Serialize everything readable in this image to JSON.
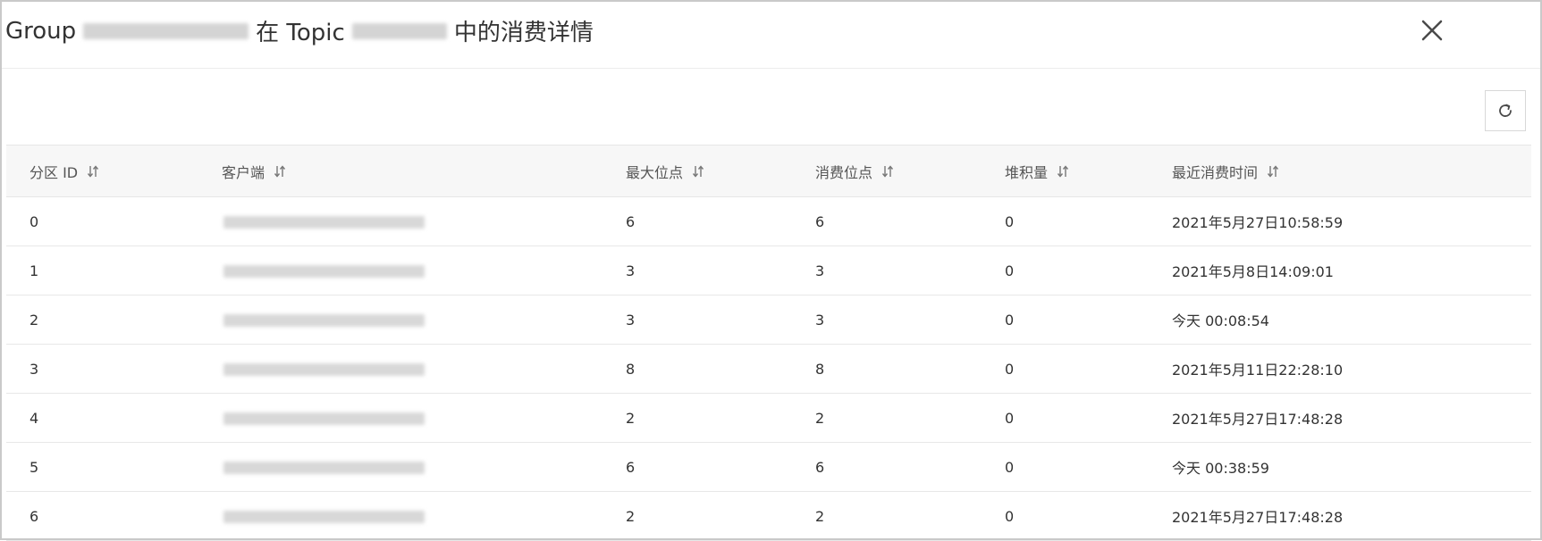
{
  "dialog": {
    "title": {
      "prefix": "Group",
      "middle": "在 Topic",
      "suffix": "中的消费详情"
    },
    "close_icon": "close-icon",
    "refresh_icon": "refresh-icon"
  },
  "table": {
    "headers": [
      "分区 ID",
      "客户端",
      "最大位点",
      "消费位点",
      "堆积量",
      "最近消费时间"
    ],
    "rows": [
      [
        "0",
        "6",
        "6",
        "0",
        "2021年5月27日10:58:59"
      ],
      [
        "1",
        "3",
        "3",
        "0",
        "2021年5月8日14:09:01"
      ],
      [
        "2",
        "3",
        "3",
        "0",
        "今天 00:08:54"
      ],
      [
        "3",
        "8",
        "8",
        "0",
        "2021年5月11日22:28:10"
      ],
      [
        "4",
        "2",
        "2",
        "0",
        "2021年5月27日17:48:28"
      ],
      [
        "5",
        "6",
        "6",
        "0",
        "今天 00:38:59"
      ],
      [
        "6",
        "2",
        "2",
        "0",
        "2021年5月27日17:48:28"
      ]
    ]
  },
  "colors": {
    "border": "#c9c9c9",
    "header_bg": "#f7f7f7",
    "text": "#333333"
  }
}
